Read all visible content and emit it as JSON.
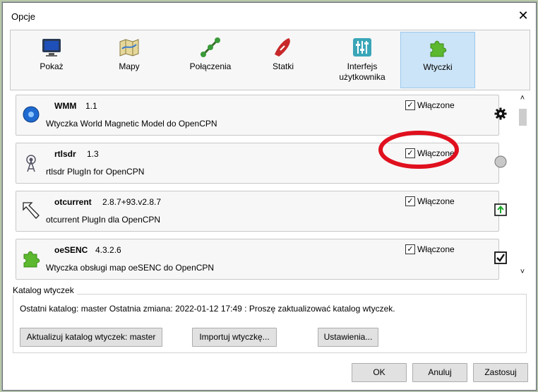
{
  "window": {
    "title": "Opcje",
    "close_glyph": "✕"
  },
  "toolbar": [
    {
      "label": "Pokaż",
      "icon": "monitor-icon"
    },
    {
      "label": "Mapy",
      "icon": "map-icon"
    },
    {
      "label": "Połączenia",
      "icon": "connections-icon"
    },
    {
      "label": "Statki",
      "icon": "ship-icon"
    },
    {
      "label": "Interfejs użytkownika",
      "icon": "sliders-icon"
    },
    {
      "label": "Wtyczki",
      "icon": "puzzle-icon",
      "selected": true
    }
  ],
  "plugins": [
    {
      "name": "WMM",
      "version": "1.1",
      "description": "Wtyczka World Magnetic Model do OpenCPN",
      "enabled_label": "Włączone",
      "enabled": true,
      "icon": "globe-icon",
      "action_icon": "gear-icon"
    },
    {
      "name": "rtlsdr",
      "version": "1.3",
      "description": "rtlsdr PlugIn for OpenCPN",
      "enabled_label": "Włączone",
      "enabled": true,
      "icon": "antenna-icon",
      "action_icon": "circle-icon"
    },
    {
      "name": "otcurrent",
      "version": "2.8.7+93.v2.8.7",
      "description": "otcurrent PlugIn dla OpenCPN",
      "enabled_label": "Włączone",
      "enabled": true,
      "icon": "arrow-icon",
      "action_icon": "upload-icon"
    },
    {
      "name": "oeSENC",
      "version": "4.3.2.6",
      "description": "Wtyczka obsługi map oeSENC do OpenCPN",
      "enabled_label": "Włączone",
      "enabled": true,
      "icon": "puzzle-icon",
      "action_icon": "checkbox-icon"
    }
  ],
  "catalog": {
    "title": "Katalog wtyczek",
    "status": "Ostatni katalog: master  Ostatnia zmiana: 2022-01-12 17:49  : Proszę zaktualizować katalog wtyczek.",
    "update_button": "Aktualizuj katalog wtyczek: master",
    "import_button": "Importuj wtyczkę...",
    "settings_button": "Ustawienia..."
  },
  "footer": {
    "ok": "OK",
    "cancel": "Anuluj",
    "apply": "Zastosuj"
  },
  "colors": {
    "selected_tab": "#cce4f7",
    "annotation_red": "#e0101e",
    "annotation_yellow": "#f5f000"
  }
}
